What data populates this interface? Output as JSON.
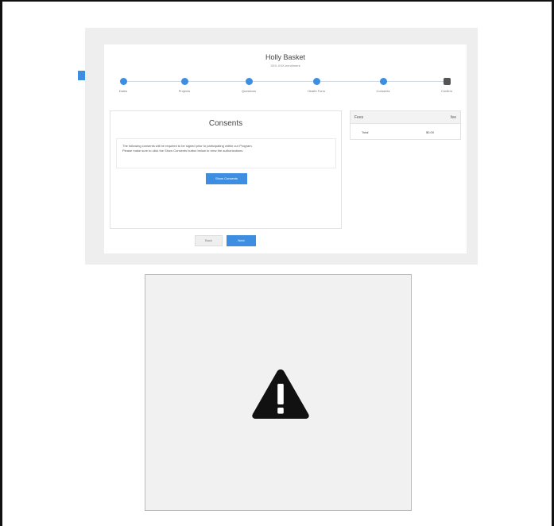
{
  "card": {
    "title": "Holly Basket",
    "subtitle": "XXX-XXX-enrollment"
  },
  "stepper": {
    "steps": [
      {
        "label": "Dates"
      },
      {
        "label": "Projects"
      },
      {
        "label": "Questions"
      },
      {
        "label": "Health Form"
      },
      {
        "label": "Consents"
      },
      {
        "label": "Confirm"
      }
    ]
  },
  "consents": {
    "title": "Consents",
    "text_line1": "The following consents will be required to be signed prior to participating within our Program.",
    "text_line2": "Please make sure to click the Show Consents button below to view the authorizations.",
    "button_label": "Show Consents"
  },
  "fees": {
    "header": "Fees",
    "toggle": "fee",
    "row_label": "Total",
    "row_value": "$0.00"
  },
  "nav": {
    "back_label": "Back",
    "next_label": "Next"
  },
  "colors": {
    "accent": "#3d8ee0",
    "background": "#eeeeee"
  },
  "icons": {
    "placeholder": "warning-icon"
  }
}
